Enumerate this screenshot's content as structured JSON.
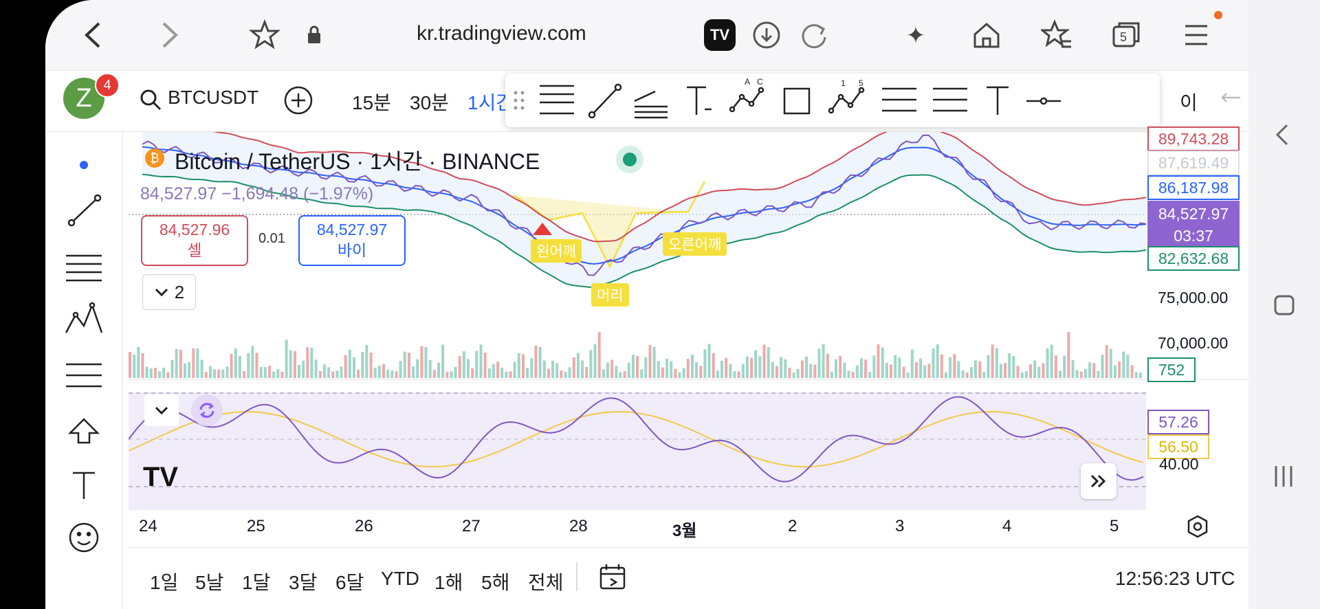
{
  "browser": {
    "url": "kr.tradingview.com",
    "tabs_count": "5"
  },
  "toolbar": {
    "avatar_letter": "Z",
    "notification_count": "4",
    "symbol": "BTCUSDT",
    "intervals": [
      "15분",
      "30분",
      "1시간"
    ],
    "more_label": "이"
  },
  "legend": {
    "title": "Bitcoin / TetherUS · 1시간 · BINANCE",
    "price_line": "84,527.97  −1,694.48 (−1.97%)",
    "sell_price": "84,527.96",
    "sell_label": "셀",
    "spread": "0.01",
    "buy_price": "84,527.97",
    "buy_label": "바이",
    "collapse_count": "2"
  },
  "price_axis": {
    "upper_band": "89,743.28",
    "label_2": "87,619.49",
    "middle_band": "86,187.98",
    "last_price": "84,527.97",
    "countdown": "03:37",
    "lower_band": "82,632.68",
    "tick_75000": "75,000.00",
    "tick_70000": "70,000.00",
    "volume": "752"
  },
  "rsi": {
    "rsi_value": "57.26",
    "ma_value": "56.50",
    "tick_40": "40.00"
  },
  "pattern_labels": {
    "left_shoulder": "왼어깨",
    "head": "머리",
    "right_shoulder": "오른어깨"
  },
  "time_axis": [
    "24",
    "25",
    "26",
    "27",
    "28",
    "3월",
    "2",
    "3",
    "4",
    "5"
  ],
  "bottom": {
    "ranges": [
      "1일",
      "5날",
      "1달",
      "3달",
      "6달",
      "YTD",
      "1해",
      "5해",
      "전체"
    ],
    "clock": "12:56:23 UTC"
  },
  "colors": {
    "upper_band": "#d24b59",
    "middle_band": "#2962ff",
    "lower_band": "#1b8f6a",
    "rsi_line": "#7e57c2",
    "rsi_ma": "#f2c94c",
    "accent_blue": "#2962ff"
  },
  "chart_data": {
    "type": "line",
    "title": "Bitcoin / TetherUS · 1시간 · BINANCE",
    "x": [
      "24",
      "25",
      "26",
      "27",
      "28",
      "3월",
      "2",
      "3",
      "4",
      "5"
    ],
    "series": [
      {
        "name": "",
        "values": [
          91000,
          89200,
          88100,
          86500,
          80500,
          84900,
          86200,
          91800,
          84400,
          84527.97
        ]
      }
    ],
    "ylim": [
      68000,
      92000
    ]
  }
}
